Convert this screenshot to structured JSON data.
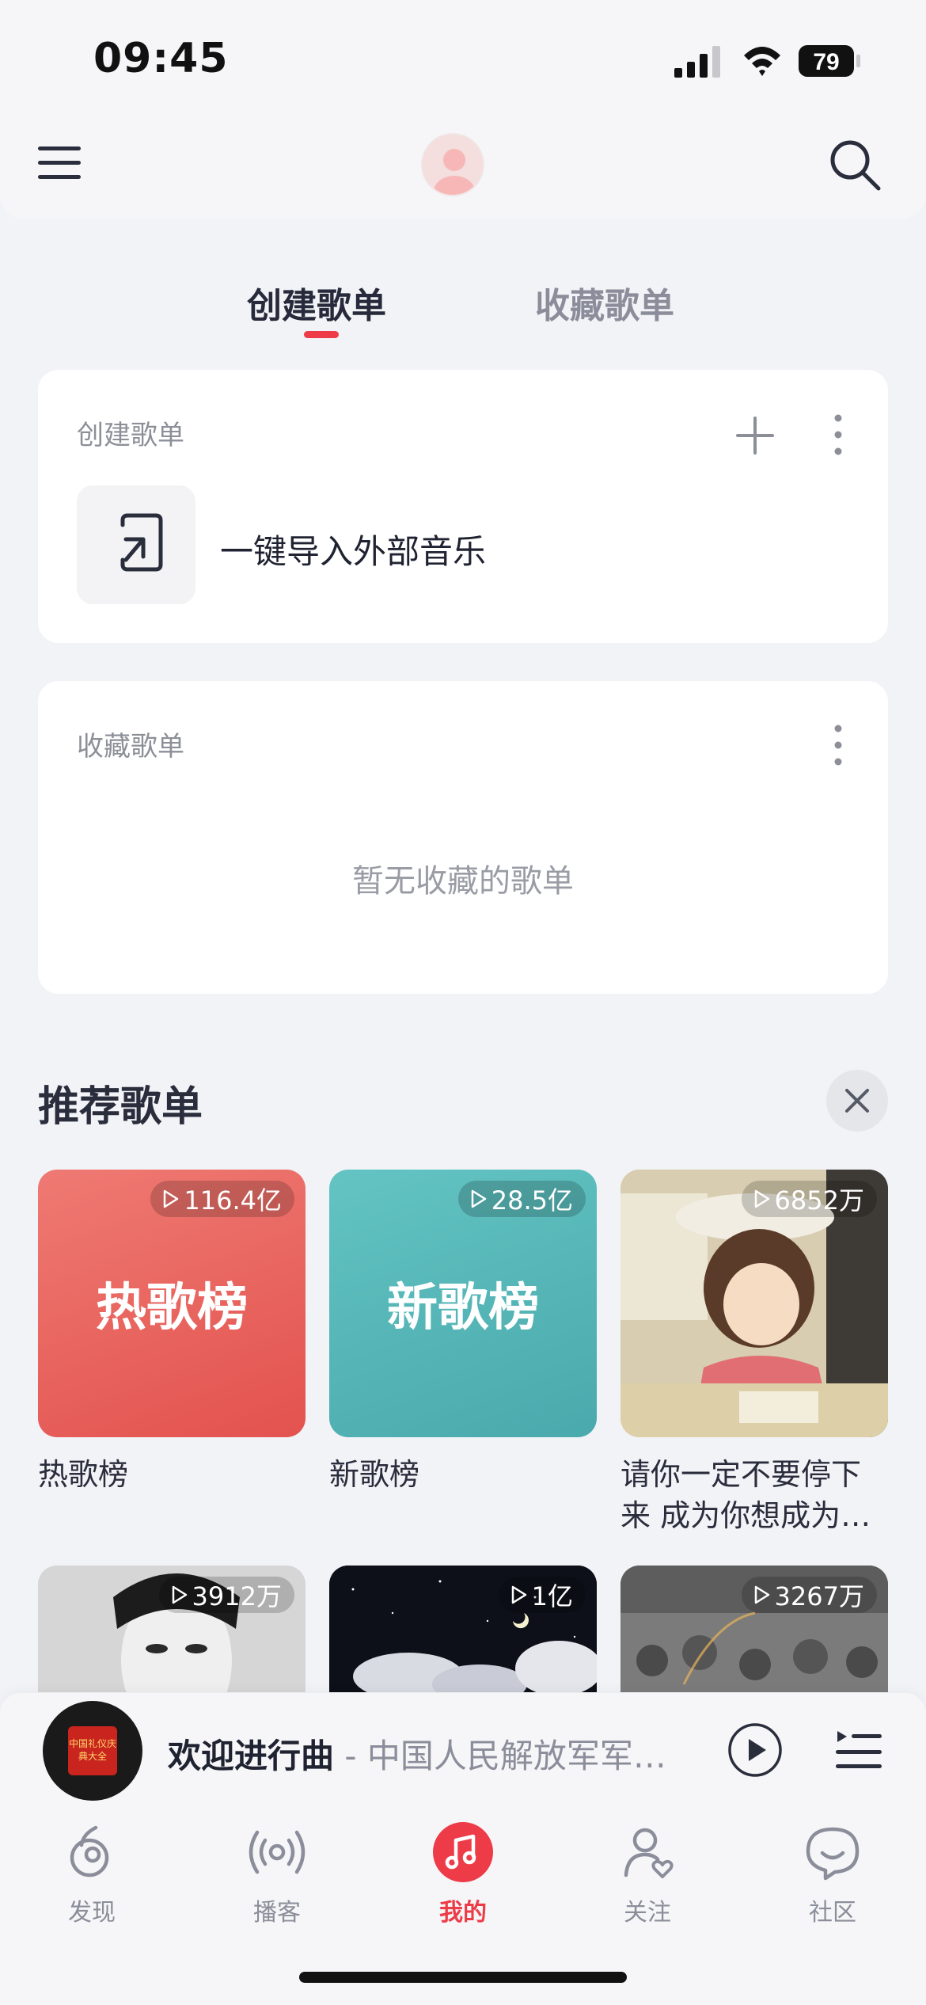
{
  "status_bar": {
    "time": "09:45",
    "battery": "79"
  },
  "tabs": [
    {
      "label": "创建歌单",
      "active": true
    },
    {
      "label": "收藏歌单",
      "active": false
    }
  ],
  "create_card": {
    "title": "创建歌单",
    "import_label": "一键导入外部音乐"
  },
  "collect_card": {
    "title": "收藏歌单",
    "empty_text": "暂无收藏的歌单"
  },
  "recommend": {
    "title": "推荐歌单",
    "playlists": [
      {
        "cover_text": "热歌榜",
        "plays": "116.4亿",
        "name": "热歌榜"
      },
      {
        "cover_text": "新歌榜",
        "plays": "28.5亿",
        "name": "新歌榜"
      },
      {
        "cover_text": "",
        "plays": "6852万",
        "name": "请你一定不要停下来 成为你想成为…"
      },
      {
        "cover_text": "",
        "plays": "3912万",
        "name": ""
      },
      {
        "cover_text": "",
        "plays": "1亿",
        "name": ""
      },
      {
        "cover_text": "",
        "plays": "3267万",
        "name": ""
      }
    ]
  },
  "player": {
    "title": "欢迎进行曲",
    "artist": " - 中国人民解放军军…",
    "disc_text": "中国礼仪庆典大全"
  },
  "nav": [
    {
      "label": "发现",
      "icon": "discover-icon",
      "active": false
    },
    {
      "label": "播客",
      "icon": "podcast-icon",
      "active": false
    },
    {
      "label": "我的",
      "icon": "music-note-icon",
      "active": true
    },
    {
      "label": "关注",
      "icon": "follow-icon",
      "active": false
    },
    {
      "label": "社区",
      "icon": "community-icon",
      "active": false
    }
  ],
  "colors": {
    "accent": "#ee3b48",
    "background": "#f2f3f7"
  }
}
